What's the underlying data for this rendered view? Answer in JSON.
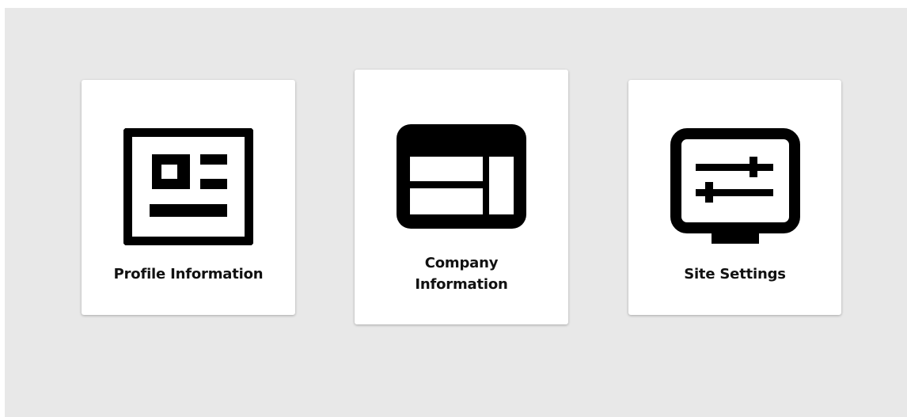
{
  "cards": [
    {
      "label": "Profile Information",
      "icon": "profile-card-icon"
    },
    {
      "label": "Company Information",
      "icon": "company-layout-icon"
    },
    {
      "label": "Site Settings",
      "icon": "monitor-settings-icon"
    }
  ],
  "colors": {
    "background": "#e8e8e8",
    "card": "#ffffff",
    "icon": "#000000",
    "text": "#111111"
  }
}
